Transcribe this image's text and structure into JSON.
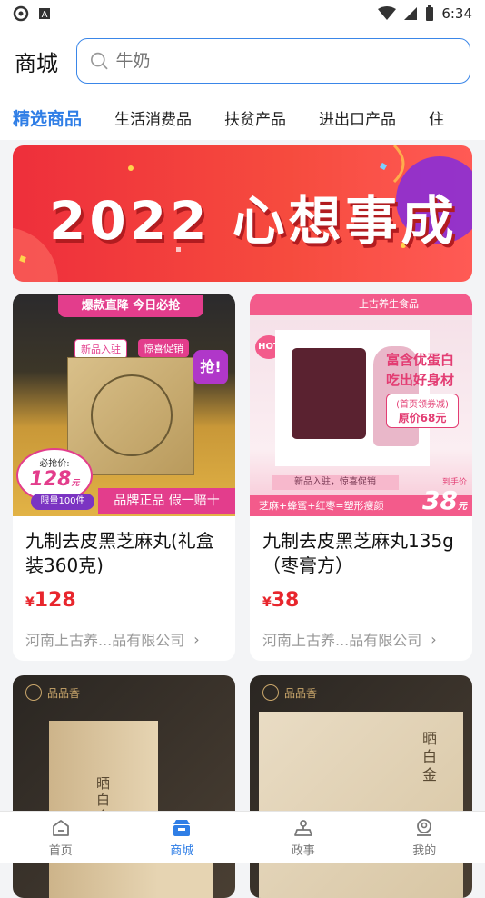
{
  "status_bar": {
    "time": "6:34"
  },
  "header": {
    "title": "商城",
    "search_placeholder": "牛奶"
  },
  "tabs": [
    {
      "label": "精选商品",
      "active": true
    },
    {
      "label": "生活消费品",
      "active": false
    },
    {
      "label": "扶贫产品",
      "active": false
    },
    {
      "label": "进出口产品",
      "active": false
    },
    {
      "label": "住",
      "active": false
    }
  ],
  "banner": {
    "text": "2022 心想事成"
  },
  "products": [
    {
      "title": "九制去皮黑芝麻丸(礼盒装360克)",
      "price_symbol": "¥",
      "price": "128",
      "shop": "河南上古养...品有限公司",
      "image": {
        "ribbon": "爆款直降 今日必抢",
        "tag1": "新品入驻",
        "tag2": "惊喜促销",
        "grab": "抢!",
        "price_label": "必抢价:",
        "price_value": "128",
        "price_unit": "元",
        "limit": "限量100件",
        "slogan": "品牌正品 假一赔十"
      }
    },
    {
      "title": "九制去皮黑芝麻丸135g（枣膏方）",
      "price_symbol": "¥",
      "price": "38",
      "shop": "河南上古养...品有限公司",
      "image": {
        "brand": "上古养生食品",
        "hot": "HOT",
        "line1": "富含优蛋白",
        "line2": "吃出好身材",
        "coupon": "(首页领券减)",
        "orig": "原价68元",
        "strip": "新品入驻，惊喜促销",
        "bottom": "芝麻+蜂蜜+红枣=塑形瘦颜",
        "deal_label": "到手价",
        "deal_price": "38",
        "deal_unit": "元"
      }
    },
    {
      "title": "",
      "price_symbol": "",
      "price": "",
      "shop": "",
      "image": {
        "brand": "品品香",
        "product": "晒白金"
      }
    },
    {
      "title": "",
      "price_symbol": "",
      "price": "",
      "shop": "",
      "image": {
        "brand": "品品香",
        "product": "晒白金"
      }
    }
  ],
  "bottom_nav": [
    {
      "label": "首页",
      "icon": "home-icon",
      "active": false
    },
    {
      "label": "商城",
      "icon": "shop-icon",
      "active": true
    },
    {
      "label": "政事",
      "icon": "government-icon",
      "active": false
    },
    {
      "label": "我的",
      "icon": "user-icon",
      "active": false
    }
  ],
  "colors": {
    "accent": "#2f7ee6",
    "price": "#e8262d",
    "banner": "#ee2f3b"
  }
}
